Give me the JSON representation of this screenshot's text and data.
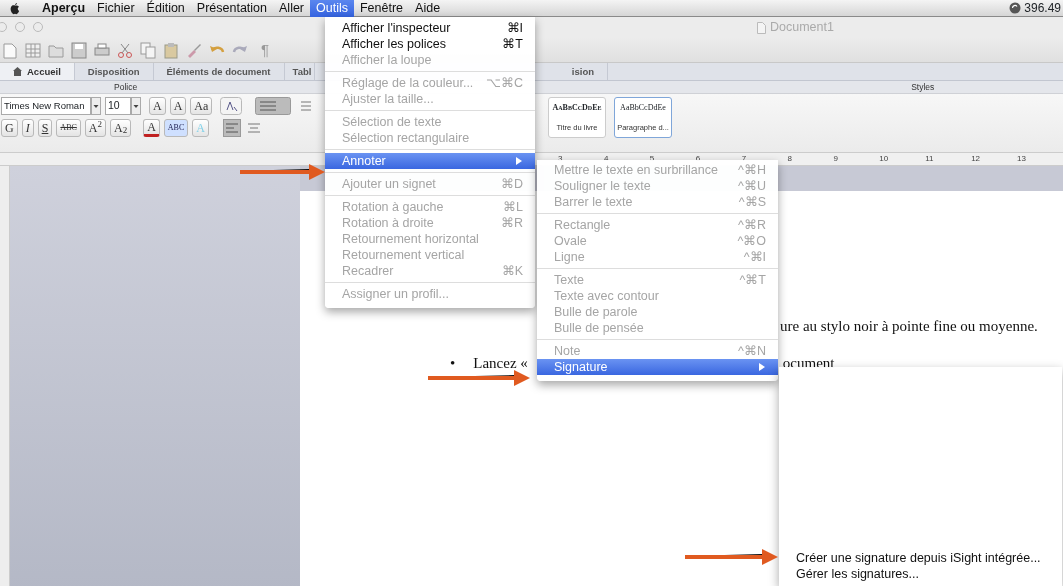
{
  "menu_bar": {
    "items": [
      {
        "label": "Aperçu",
        "kind": "app",
        "selected": false
      },
      {
        "label": "Fichier",
        "kind": "menu",
        "selected": false
      },
      {
        "label": "Édition",
        "kind": "menu",
        "selected": false
      },
      {
        "label": "Présentation",
        "kind": "menu",
        "selected": false
      },
      {
        "label": "Aller",
        "kind": "menu",
        "selected": false
      },
      {
        "label": "Outils",
        "kind": "menu",
        "selected": true
      },
      {
        "label": "Fenêtre",
        "kind": "menu",
        "selected": false
      },
      {
        "label": "Aide",
        "kind": "menu",
        "selected": false
      }
    ],
    "status": "396.49"
  },
  "window": {
    "title": "Document1"
  },
  "toolbar": {
    "pilcrow": "¶"
  },
  "ribbon": {
    "tabs": [
      {
        "label": "Accueil",
        "selected": true
      },
      {
        "label": "Disposition",
        "selected": false
      },
      {
        "label": "Éléments de document",
        "selected": false
      },
      {
        "label": "Tabl",
        "selected": false
      }
    ],
    "tab_tail": "ision",
    "groups": [
      "Police",
      "Styles"
    ],
    "font": "Times New Roman",
    "size": "10",
    "size_buttons": [
      "A",
      "A",
      "Aa"
    ],
    "format_buttons": [
      {
        "label": "G",
        "kind": "bold"
      },
      {
        "label": "I",
        "kind": "italic"
      },
      {
        "label": "S",
        "kind": "underline"
      },
      {
        "label": "ABC",
        "kind": "strike"
      },
      {
        "label": "A$^{2}$",
        "kind": "plain"
      },
      {
        "label": "A$_{2}$",
        "kind": "plain"
      },
      {
        "label": "A",
        "kind": "color"
      },
      {
        "label": "ABC",
        "kind": "highlight"
      },
      {
        "label": "A",
        "kind": "effect"
      }
    ],
    "styles": [
      {
        "preview": "AaBbCcDdEe",
        "name": "Titre du livre",
        "small_caps": true,
        "selected": false
      },
      {
        "preview": "AaBbCcDdEe",
        "name": "Paragraphe d...",
        "small_caps": false,
        "selected": true
      }
    ]
  },
  "ruler": [
    "3",
    "4",
    "5",
    "6",
    "7",
    "8",
    "9",
    "10",
    "11",
    "12",
    "13"
  ],
  "document": {
    "line_1": "ure au stylo noir à pointe fine ou moyenne.",
    "bullet": "•",
    "line_2_start": "Lancez «",
    "line_2_end": "ocument"
  },
  "outils_menu": {
    "sections": [
      {
        "items": [
          {
            "label": "Afficher l'inspecteur",
            "shortcut": "⌘I",
            "disabled": false,
            "selected": false,
            "submenu": false
          },
          {
            "label": "Afficher les polices",
            "shortcut": "⌘T",
            "disabled": false,
            "selected": false,
            "submenu": false
          },
          {
            "label": "Afficher la loupe",
            "disabled": true,
            "selected": false,
            "submenu": false
          }
        ]
      },
      {
        "items": [
          {
            "label": "Réglage de la couleur...",
            "shortcut": "⌥⌘C",
            "disabled": true,
            "selected": false,
            "submenu": false
          },
          {
            "label": "Ajuster la taille...",
            "disabled": true,
            "selected": false,
            "submenu": false
          }
        ]
      },
      {
        "items": [
          {
            "label": "Sélection de texte",
            "disabled": true,
            "selected": false,
            "submenu": false
          },
          {
            "label": "Sélection rectangulaire",
            "disabled": true,
            "selected": false,
            "submenu": false
          }
        ]
      },
      {
        "items": [
          {
            "label": "Annoter",
            "disabled": false,
            "selected": true,
            "submenu": true
          }
        ]
      },
      {
        "items": [
          {
            "label": "Ajouter un signet",
            "shortcut": "⌘D",
            "disabled": true,
            "selected": false,
            "submenu": false
          }
        ]
      },
      {
        "items": [
          {
            "label": "Rotation à gauche",
            "shortcut": "⌘L",
            "disabled": true,
            "selected": false,
            "submenu": false
          },
          {
            "label": "Rotation à droite",
            "shortcut": "⌘R",
            "disabled": true,
            "selected": false,
            "submenu": false
          },
          {
            "label": "Retournement horizontal",
            "disabled": true,
            "selected": false,
            "submenu": false
          },
          {
            "label": "Retournement vertical",
            "disabled": true,
            "selected": false,
            "submenu": false
          },
          {
            "label": "Recadrer",
            "shortcut": "⌘K",
            "disabled": true,
            "selected": false,
            "submenu": false
          }
        ]
      },
      {
        "items": [
          {
            "label": "Assigner un profil...",
            "disabled": true,
            "selected": false,
            "submenu": false
          }
        ]
      }
    ]
  },
  "annoter_menu": {
    "sections": [
      {
        "items": [
          {
            "label": "Mettre le texte en surbrillance",
            "shortcut": "^⌘H",
            "disabled": true,
            "selected": false,
            "submenu": false
          },
          {
            "label": "Souligner le texte",
            "shortcut": "^⌘U",
            "disabled": true,
            "selected": false,
            "submenu": false
          },
          {
            "label": "Barrer le texte",
            "shortcut": "^⌘S",
            "disabled": true,
            "selected": false,
            "submenu": false
          }
        ]
      },
      {
        "items": [
          {
            "label": "Rectangle",
            "shortcut": "^⌘R",
            "disabled": true,
            "selected": false,
            "submenu": false
          },
          {
            "label": "Ovale",
            "shortcut": "^⌘O",
            "disabled": true,
            "selected": false,
            "submenu": false
          },
          {
            "label": "Ligne",
            "shortcut": "^⌘I",
            "disabled": true,
            "selected": false,
            "submenu": false
          }
        ]
      },
      {
        "items": [
          {
            "label": "Texte",
            "shortcut": "^⌘T",
            "disabled": true,
            "selected": false,
            "submenu": false
          },
          {
            "label": "Texte avec contour",
            "disabled": true,
            "selected": false,
            "submenu": false
          },
          {
            "label": "Bulle de parole",
            "disabled": true,
            "selected": false,
            "submenu": false
          },
          {
            "label": "Bulle de pensée",
            "disabled": true,
            "selected": false,
            "submenu": false
          }
        ]
      },
      {
        "items": [
          {
            "label": "Note",
            "shortcut": "^⌘N",
            "disabled": true,
            "selected": false,
            "submenu": false
          },
          {
            "label": "Signature",
            "disabled": false,
            "selected": true,
            "submenu": true
          }
        ]
      }
    ]
  },
  "signature_menu": {
    "items": [
      {
        "label": "Créer une signature depuis iSight intégrée...",
        "disabled": false,
        "selected": false
      },
      {
        "label": "Gérer les signatures...",
        "disabled": false,
        "selected": false
      }
    ]
  }
}
